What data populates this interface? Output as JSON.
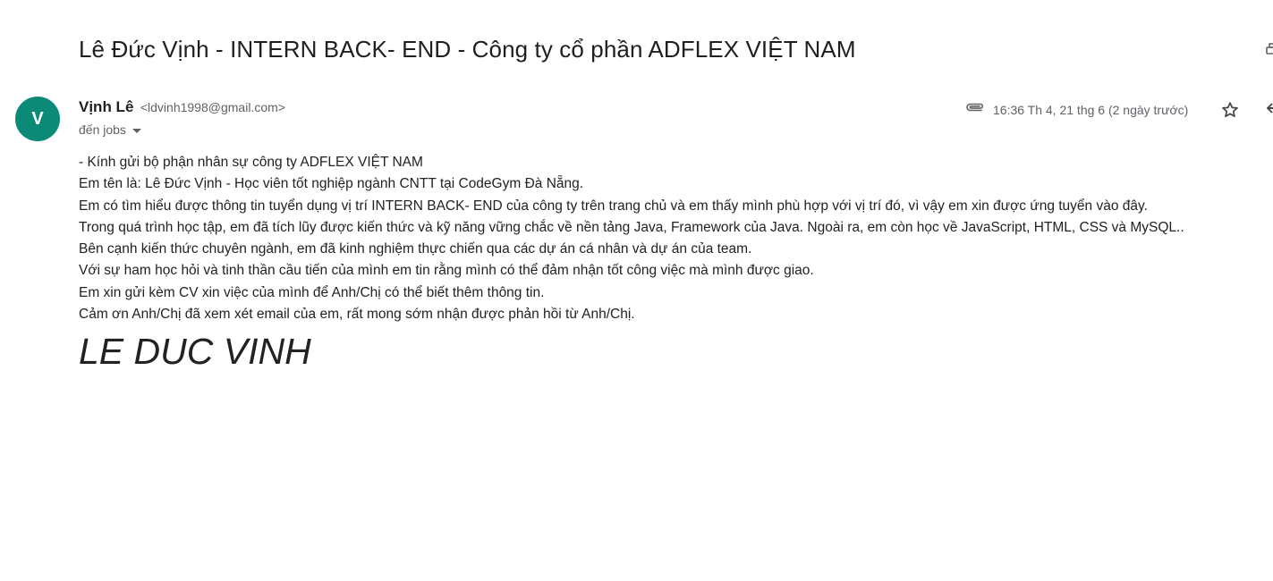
{
  "email": {
    "subject": "Lê Đức Vịnh - INTERN BACK- END - Công ty cổ phần ADFLEX VIỆT NAM",
    "avatar_letter": "V",
    "sender_name": "Vịnh Lê",
    "sender_email": "<ldvinh1998@gmail.com>",
    "recipient": "đến jobs",
    "date": "16:36 Th 4, 21 thg 6 (2 ngày trước)",
    "body": [
      "- Kính gửi bộ phận nhân sự công ty ADFLEX VIỆT NAM",
      "Em tên là: Lê Đức Vịnh - Học viên tốt nghiệp ngành CNTT tại CodeGym Đà Nẵng.",
      "Em có tìm hiểu được thông tin tuyển dụng vị trí INTERN BACK- END của công ty trên trang chủ và em thấy mình phù hợp với vị trí đó, vì vậy em xin được ứng tuyển vào đây.",
      "Trong quá trình học tập, em đã tích lũy được kiến thức và kỹ năng vững chắc về nền tảng Java, Framework của Java. Ngoài ra, em còn học về JavaScript, HTML, CSS và MySQL..",
      "Bên cạnh kiến thức chuyên ngành, em đã kinh nghiệm thực chiến qua các dự án cá nhân và dự án của team.",
      "Với sự ham học hỏi và tinh thần cầu tiến của mình em tin rằng mình có thể đảm nhận tốt công việc mà mình được giao.",
      "Em xin gửi kèm CV xin việc của mình để Anh/Chị có thể biết thêm thông tin.",
      "Cảm ơn Anh/Chị đã xem xét email của em, rất mong sớm nhận được phản hồi từ Anh/Chị."
    ],
    "signature": "LE DUC VINH"
  },
  "icons": {
    "attachment": "paperclip-icon",
    "star": "star-icon",
    "print": "print-icon",
    "reply": "reply-icon",
    "recipient_details": "chevron-down-icon"
  },
  "colors": {
    "avatar": "#0b8b77",
    "text": "#222222",
    "meta": "#5f6368"
  }
}
